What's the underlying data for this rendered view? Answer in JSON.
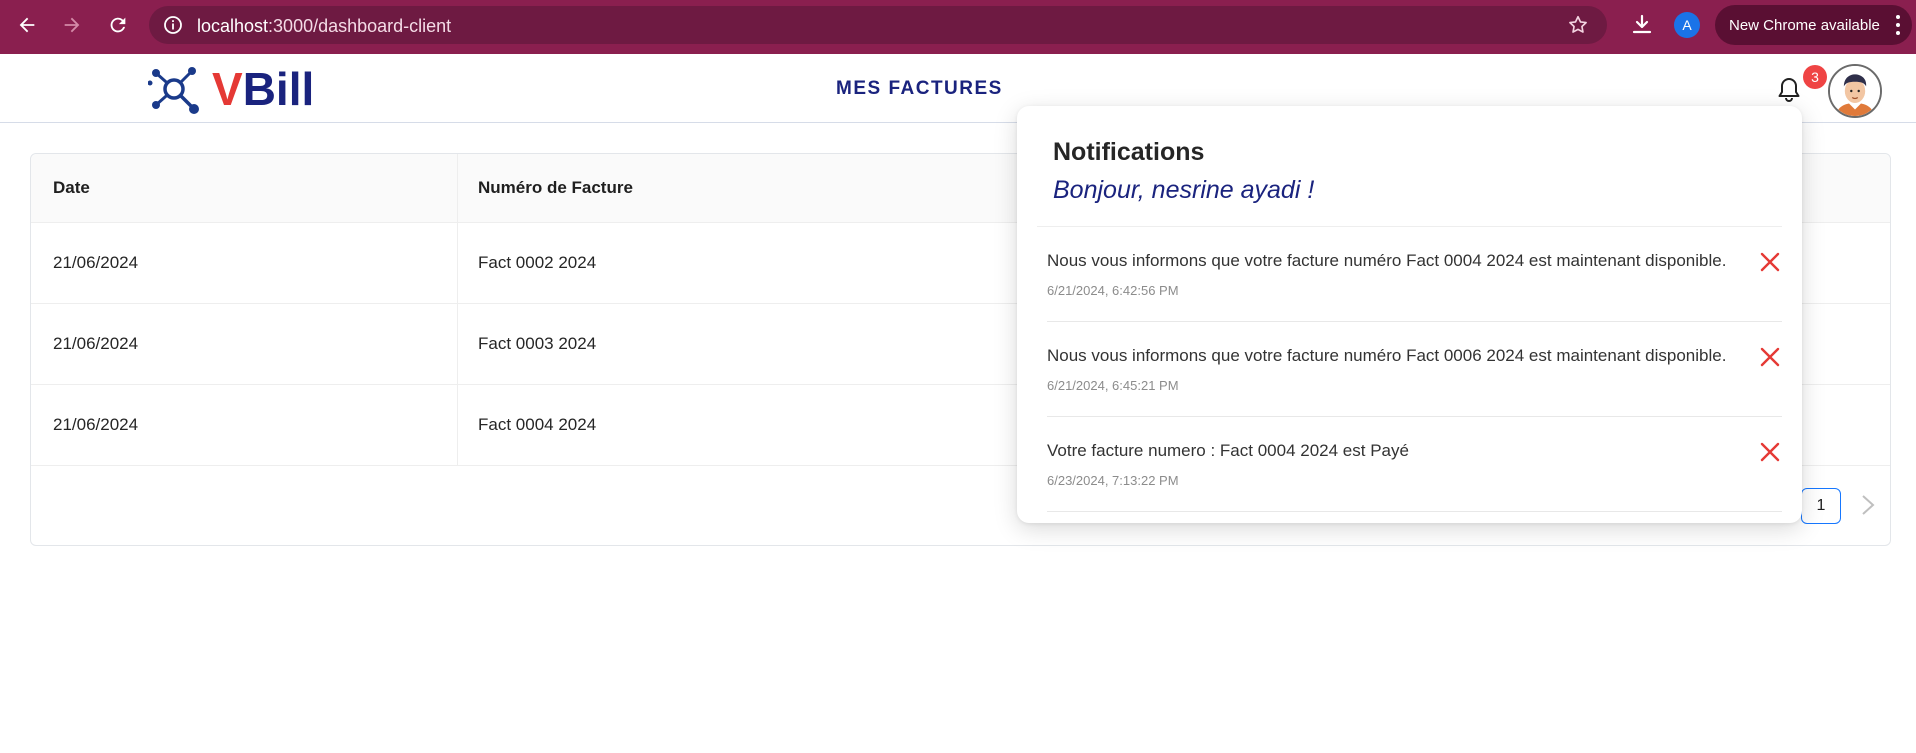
{
  "browser": {
    "url_host": "localhost",
    "url_path": ":3000/dashboard-client",
    "profile_initial": "A",
    "new_chrome_label": "New Chrome available"
  },
  "header": {
    "logo_v": "V",
    "logo_rest": "Bill",
    "title": "MES FACTURES",
    "notification_count": "3"
  },
  "table": {
    "columns": [
      "Date",
      "Numéro de Facture"
    ],
    "rows": [
      {
        "date": "21/06/2024",
        "numero": "Fact 0002 2024"
      },
      {
        "date": "21/06/2024",
        "numero": "Fact 0003 2024"
      },
      {
        "date": "21/06/2024",
        "numero": "Fact 0004 2024"
      }
    ],
    "pagination": {
      "current_page": "1"
    }
  },
  "notifications": {
    "title": "Notifications",
    "greeting": "Bonjour, nesrine ayadi !",
    "items": [
      {
        "message": "Nous vous informons que votre facture numéro Fact 0004 2024 est maintenant disponible.",
        "time": "6/21/2024, 6:42:56 PM"
      },
      {
        "message": "Nous vous informons que votre facture numéro Fact 0006 2024 est maintenant disponible.",
        "time": "6/21/2024, 6:45:21 PM"
      },
      {
        "message": "Votre facture numero : Fact 0004 2024 est Payé",
        "time": "6/23/2024, 7:13:22 PM"
      }
    ]
  },
  "colors": {
    "chrome_bg": "#8a1f4f",
    "brand_red": "#e53935",
    "brand_navy": "#1a237e",
    "badge_red": "#ef4444",
    "close_red": "#e53935",
    "pager_blue": "#1677ff"
  }
}
